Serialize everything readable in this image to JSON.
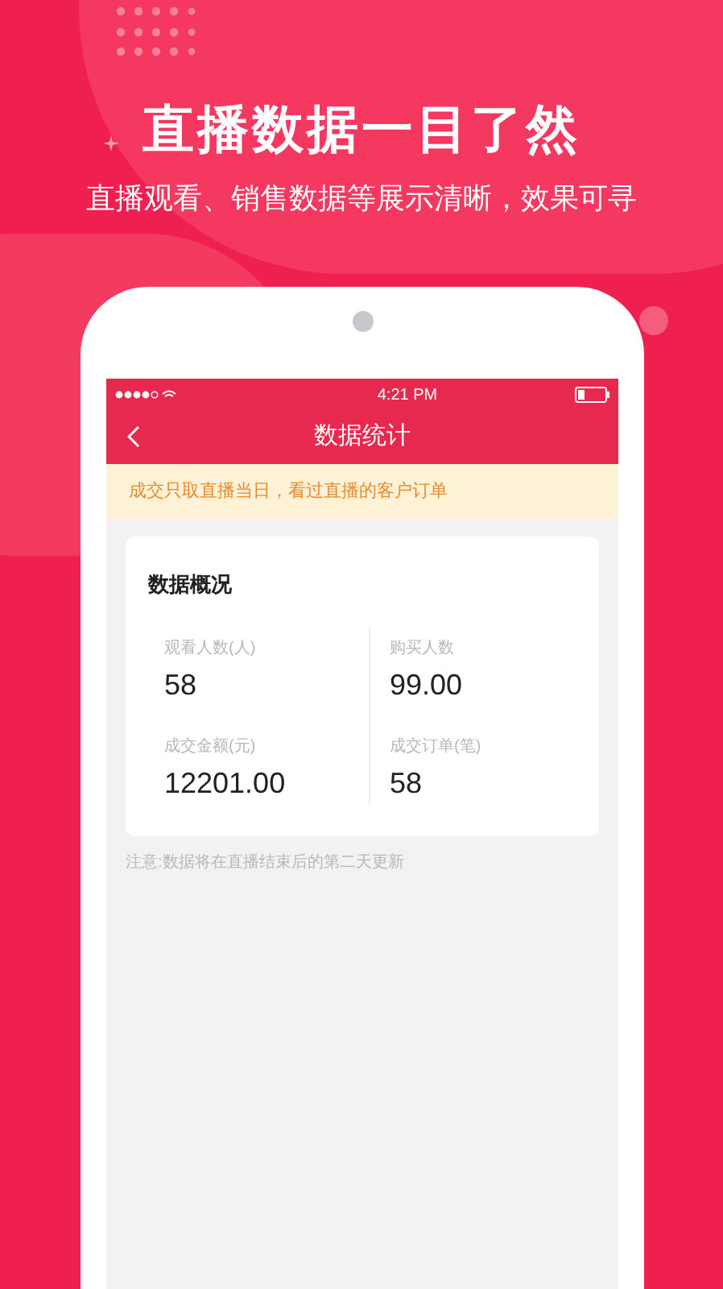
{
  "headline": "直播数据一目了然",
  "subheadline": "直播观看、销售数据等展示清晰，效果可寻",
  "phone": {
    "status_bar": {
      "time": "4:21 PM"
    },
    "nav": {
      "title": "数据统计"
    },
    "notice": "成交只取直播当日，看过直播的客户订单",
    "overview": {
      "title": "数据概况",
      "stats": [
        {
          "label": "观看人数(人)",
          "value": "58"
        },
        {
          "label": "购买人数",
          "value": "99.00"
        },
        {
          "label": "成交金额(元)",
          "value": "12201.00"
        },
        {
          "label": "成交订单(笔)",
          "value": "58"
        }
      ]
    },
    "footnote": "注意:数据将在直播结束后的第二天更新"
  }
}
